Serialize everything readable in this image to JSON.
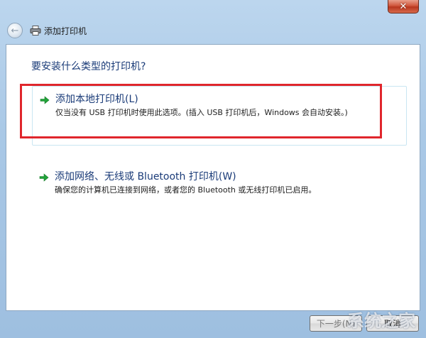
{
  "window": {
    "close_label": "✕",
    "title": "添加打印机"
  },
  "content": {
    "heading": "要安装什么类型的打印机?",
    "options": [
      {
        "title": "添加本地打印机(L)",
        "description": "仅当没有 USB 打印机时使用此选项。(插入 USB 打印机后，Windows 会自动安装。)"
      },
      {
        "title": "添加网络、无线或 Bluetooth 打印机(W)",
        "description": "确保您的计算机已连接到网络，或者您的 Bluetooth 或无线打印机已启用。"
      }
    ]
  },
  "footer": {
    "next_label": "下一步(N)",
    "cancel_label": "取消"
  },
  "watermark": "系统之家",
  "colors": {
    "highlight": "#e0262c",
    "link_blue": "#1a3b78",
    "arrow_green": "#22a33a"
  }
}
